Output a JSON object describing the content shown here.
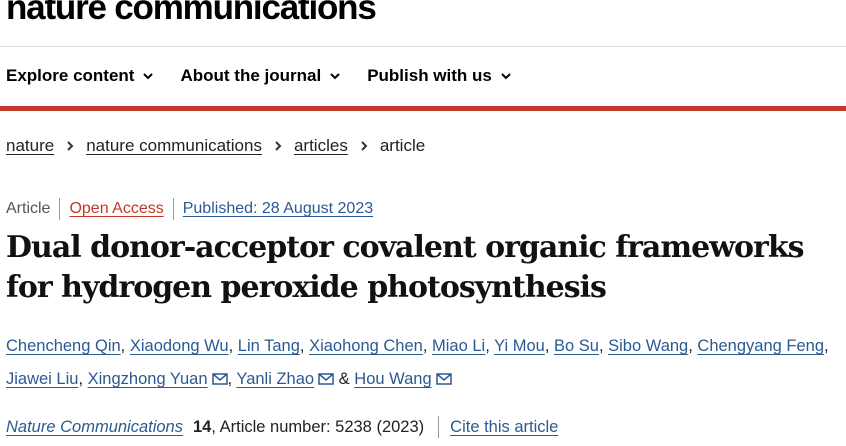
{
  "brand": {
    "name": "nature communications"
  },
  "nav": {
    "items": [
      {
        "label": "Explore content",
        "icon": "chevron-down-icon"
      },
      {
        "label": "About the journal",
        "icon": "chevron-down-icon"
      },
      {
        "label": "Publish with us",
        "icon": "chevron-down-icon"
      }
    ]
  },
  "accent_color": "#c0392b",
  "link_color": "#2b5a92",
  "breadcrumb": {
    "items": [
      "nature",
      "nature communications",
      "articles"
    ],
    "current": "article"
  },
  "meta": {
    "type": "Article",
    "access": "Open Access",
    "published": "Published: 28 August 2023"
  },
  "title": "Dual donor-acceptor covalent organic frameworks for hydrogen peroxide photosynthesis",
  "authors": [
    "Chencheng Qin",
    "Xiaodong Wu",
    "Lin Tang",
    "Xiaohong Chen",
    "Miao Li",
    "Yi Mou",
    "Bo Su",
    "Sibo Wang",
    "Chengyang Feng",
    "Jiawei Liu",
    "Xingzhong Yuan",
    "Yanli Zhao",
    "Hou Wang"
  ],
  "citation": {
    "journal": "Nature Communications",
    "volume": "14",
    "article_number": ", Article number: 5238 (2023)",
    "cite_link": "Cite this article"
  }
}
